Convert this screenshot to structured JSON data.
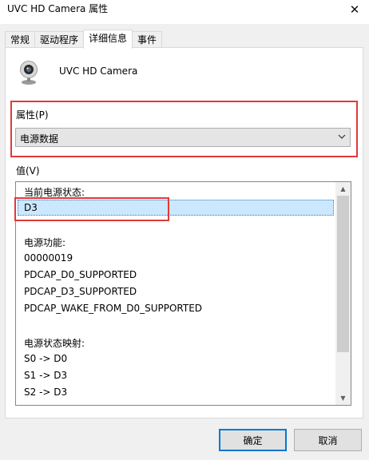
{
  "window": {
    "title": "UVC HD Camera 属性",
    "close_glyph": "✕"
  },
  "tabs": [
    {
      "label": "常规"
    },
    {
      "label": "驱动程序"
    },
    {
      "label": "详细信息"
    },
    {
      "label": "事件"
    }
  ],
  "device": {
    "name": "UVC HD Camera",
    "icon": "webcam-icon"
  },
  "property": {
    "label": "属性(P)",
    "selected": "电源数据"
  },
  "value": {
    "label": "值(V)",
    "lines": [
      "当前电源状态:",
      "D3",
      "",
      "电源功能:",
      "00000019",
      "PDCAP_D0_SUPPORTED",
      "PDCAP_D3_SUPPORTED",
      "PDCAP_WAKE_FROM_D0_SUPPORTED",
      "",
      "电源状态映射:",
      "S0 -> D0",
      "S1 -> D3",
      "S2 -> D3"
    ],
    "selected_index": 1
  },
  "buttons": {
    "ok": "确定",
    "cancel": "取消"
  },
  "colors": {
    "highlight_box": "#e03a3a",
    "selection": "#cce8ff",
    "default_button_border": "#0078d7"
  }
}
